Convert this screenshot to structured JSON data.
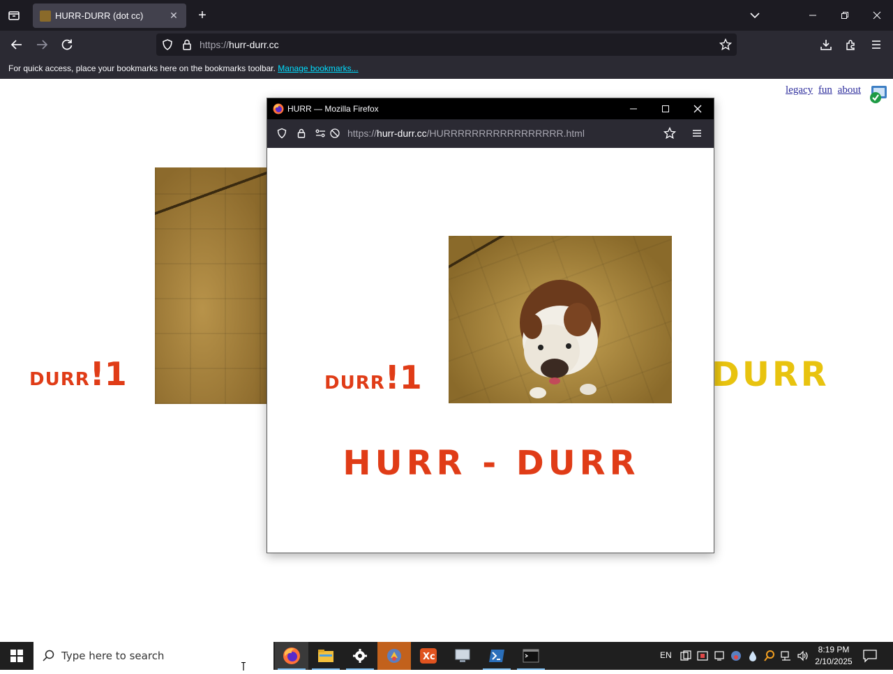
{
  "browser": {
    "tab": {
      "title": "HURR-DURR (dot cc)",
      "close": "✕"
    },
    "new_tab": "+",
    "url": {
      "scheme": "https://",
      "host": "hurr-durr.cc"
    },
    "bookmarks_bar": {
      "text": "For quick access, place your bookmarks here on the bookmarks toolbar.",
      "link": "Manage bookmarks..."
    }
  },
  "page": {
    "links": [
      "legacy",
      "fun",
      "about"
    ],
    "durr_small": "DURR",
    "durr_big": "!1",
    "durr_right": "DURR"
  },
  "popup": {
    "title": "HURR — Mozilla Firefox",
    "url": {
      "scheme": "https://",
      "host": "hurr-durr.cc",
      "path": "/HURRRRRRRRRRRRRRRRR.html"
    },
    "durr_small": "DURR",
    "durr_big": "!1",
    "headline": "HURR - DURR"
  },
  "taskbar": {
    "search_placeholder": "Type here to search",
    "language": "EN",
    "time": "8:19 PM",
    "date": "2/10/2025",
    "apps": [
      "firefox-icon",
      "file-explorer-icon",
      "settings-icon",
      "app-icon",
      "xc-icon",
      "remote-desktop-icon",
      "powershell-icon",
      "terminal-icon"
    ]
  },
  "colors": {
    "durr_red": "#e03c17",
    "durr_yellow": "#e8c30f",
    "chrome_dark": "#1c1b22",
    "chrome_bar": "#2b2a33",
    "link_cyan": "#00ddff"
  }
}
